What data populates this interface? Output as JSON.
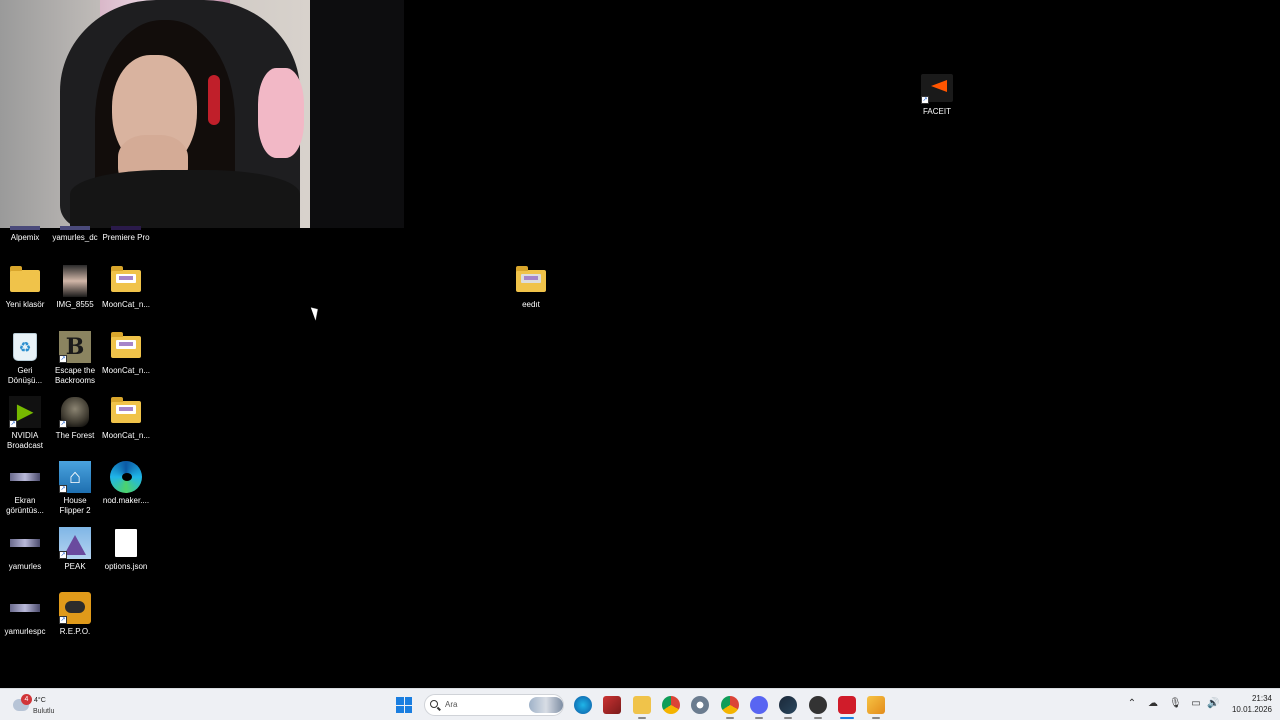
{
  "desktop": {
    "icons": {
      "alpemix": "Alpemix",
      "yamurles_dc": "yamurles_dc",
      "premiere": "Premiere Pro",
      "yeni_klasor": "Yeni klasör",
      "img_8555": "IMG_8555",
      "mooncat_1": "MoonCat_n...",
      "eedit": "eedıt",
      "geri_donusum": "Geri\nDönüşü...",
      "escape": "Escape the\nBackrooms",
      "mooncat_2": "MoonCat_n...",
      "nvidia": "NVIDIA\nBroadcast",
      "forest": "The Forest",
      "mooncat_3": "MoonCat_n...",
      "ekran": "Ekran\ngörüntüs...",
      "house": "House\nFlipper 2",
      "nod_maker": "nod.maker....",
      "yamurles": "yamurles",
      "peak": "PEAK",
      "options": "options.json",
      "yamurlespc": "yamurlespc",
      "repo": "R.E.P.O.",
      "faceit": "FACEIT"
    }
  },
  "taskbar": {
    "weather": {
      "badge": "4",
      "temp": "4°C",
      "condition": "Bulutlu"
    },
    "search_placeholder": "Ara",
    "pinned": [
      "file-explorer-icon",
      "edge-icon",
      "game-icon",
      "folder-icon",
      "chrome-icon",
      "settings-icon",
      "chrome-alt-icon",
      "discord-icon",
      "steam-icon",
      "app-icon",
      "faceit-anticheat-icon",
      "media-player-icon"
    ],
    "clock": {
      "time": "21:34",
      "date": "10.01.2026"
    }
  },
  "colors": {
    "desktop_bg": "#000000",
    "taskbar_bg": "#eef0f4",
    "accent": "#1a7ee0"
  }
}
